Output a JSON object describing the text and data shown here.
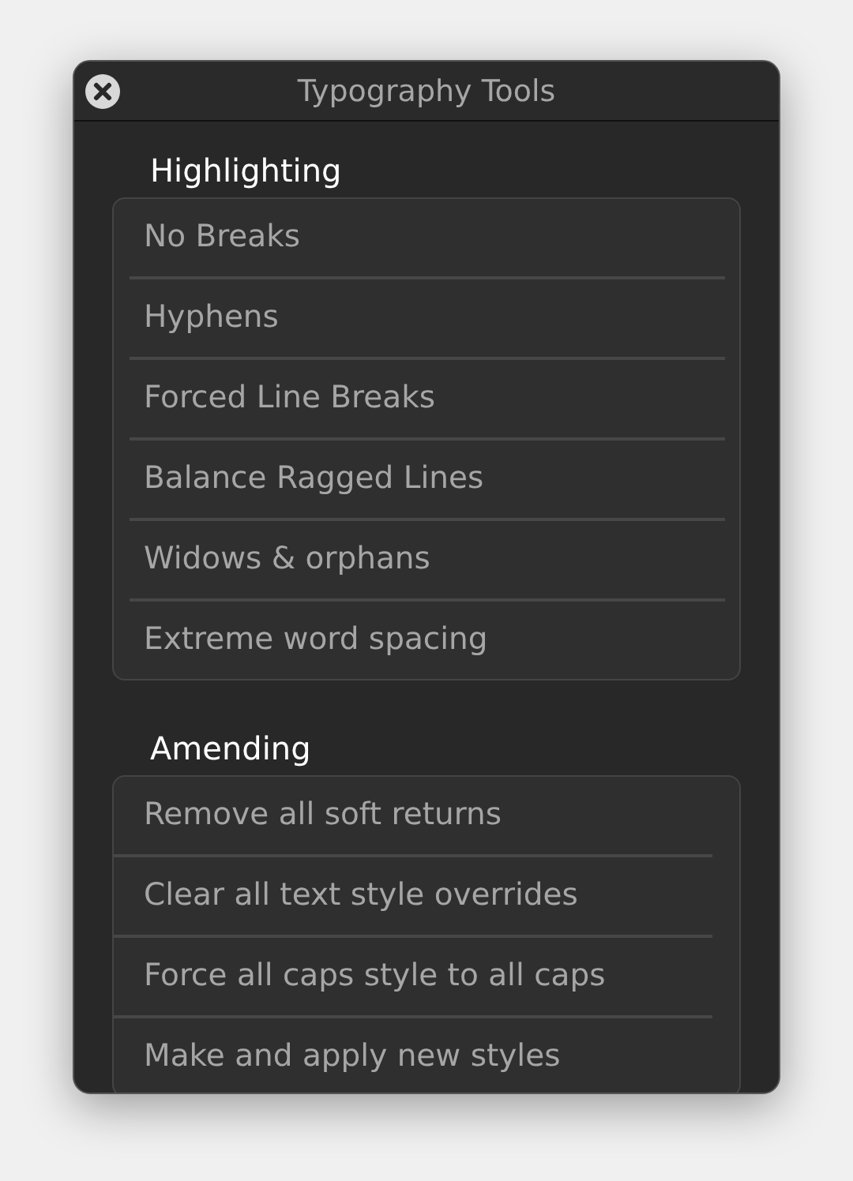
{
  "window": {
    "title": "Typography Tools"
  },
  "sections": [
    {
      "heading": "Highlighting",
      "items": [
        "No Breaks",
        "Hyphens",
        "Forced Line Breaks",
        "Balance Ragged Lines",
        "Widows & orphans",
        "Extreme word spacing"
      ]
    },
    {
      "heading": "Amending",
      "items": [
        "Remove all soft returns",
        "Clear all text style overrides",
        "Force all caps style to all caps",
        "Make and apply new styles"
      ]
    }
  ]
}
